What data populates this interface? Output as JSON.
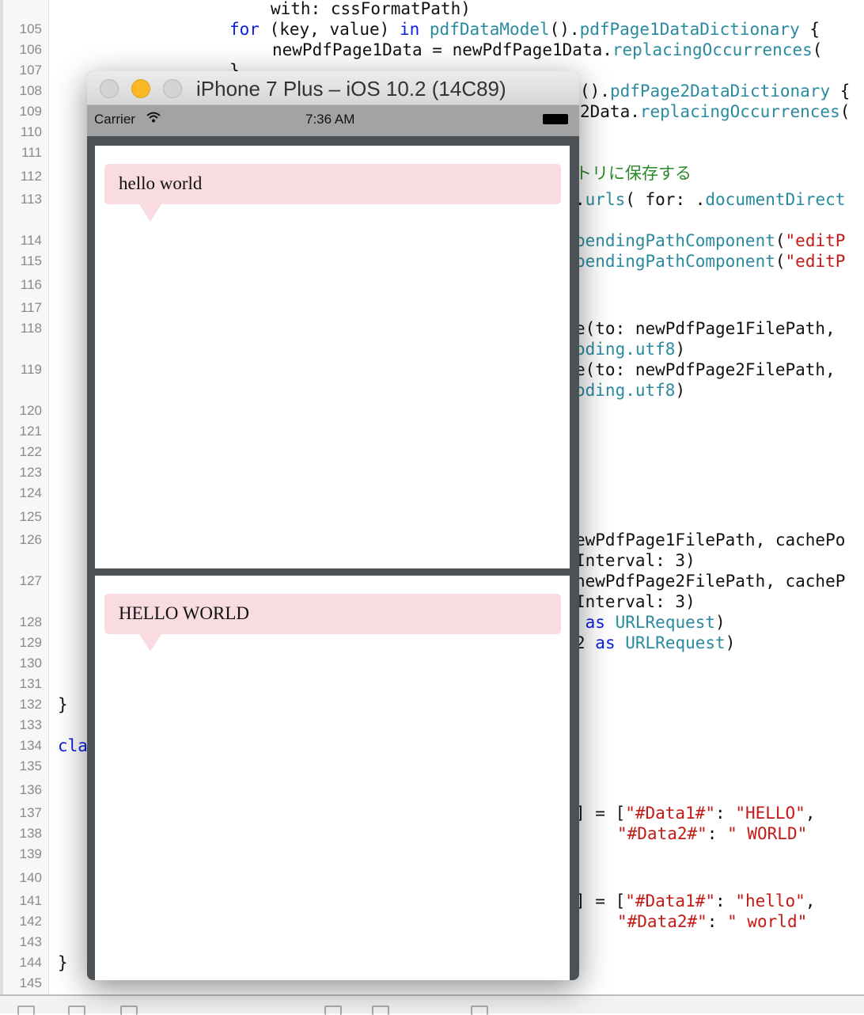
{
  "editor": {
    "line_numbers": [
      "105",
      "106",
      "107",
      "108",
      "109",
      "110",
      "111",
      "112",
      "113",
      "114",
      "115",
      "116",
      "117",
      "118",
      "119",
      "120",
      "121",
      "122",
      "123",
      "124",
      "125",
      "126",
      "127",
      "128",
      "129",
      "130",
      "131",
      "132",
      "133",
      "134",
      "135",
      "136",
      "137",
      "138",
      "139",
      "140",
      "141",
      "142",
      "143",
      "144",
      "145"
    ],
    "code": [
      [
        [
          "p",
          "with: cssFormatPath)"
        ]
      ],
      [
        [
          "k",
          "for"
        ],
        [
          "p",
          " (key, value) "
        ],
        [
          "k",
          "in"
        ],
        [
          "p",
          " "
        ],
        [
          "t",
          "pdfDataModel"
        ],
        [
          "p",
          "()."
        ],
        [
          "t",
          "pdfPage1DataDictionary"
        ],
        [
          "p",
          " {"
        ]
      ],
      [
        [
          "p",
          "newPdfPage1Data = newPdfPage1Data."
        ],
        [
          "t",
          "replacingOccurrences"
        ],
        [
          "p",
          "("
        ]
      ],
      [
        [
          "p",
          "}"
        ]
      ],
      [
        [
          "p",
          "()."
        ],
        [
          "t",
          "pdfPage2DataDictionary"
        ],
        [
          "p",
          " {"
        ]
      ],
      [
        [
          "p",
          "2Data."
        ],
        [
          "t",
          "replacingOccurrences"
        ],
        [
          "p",
          "("
        ]
      ],
      [
        [
          "c",
          "トリに保存する"
        ]
      ],
      [
        [
          "p",
          "."
        ],
        [
          "t",
          "urls"
        ],
        [
          "p",
          "( for: ."
        ],
        [
          "t",
          "documentDirect"
        ]
      ],
      [
        [
          "t",
          "pendingPathComponent"
        ],
        [
          "p",
          "("
        ],
        [
          "s",
          "\"editP"
        ]
      ],
      [
        [
          "t",
          "pendingPathComponent"
        ],
        [
          "p",
          "("
        ],
        [
          "s",
          "\"editP"
        ]
      ],
      [
        [
          "p",
          "e(to: newPdfPage1FilePath,"
        ]
      ],
      [
        [
          "t",
          "oding.utf8"
        ],
        [
          "p",
          ")"
        ]
      ],
      [
        [
          "p",
          "e(to: newPdfPage2FilePath,"
        ]
      ],
      [
        [
          "t",
          "oding.utf8"
        ],
        [
          "p",
          ")"
        ]
      ],
      [
        [
          "p",
          "ewPdfPage1FilePath, cachePo"
        ]
      ],
      [
        [
          "p",
          "Interval: 3)"
        ]
      ],
      [
        [
          "p",
          "newPdfPage2FilePath, cacheP"
        ]
      ],
      [
        [
          "p",
          "Interval: 3)"
        ]
      ],
      [
        [
          "p",
          " "
        ],
        [
          "k",
          "as"
        ],
        [
          "p",
          " "
        ],
        [
          "t",
          "URLRequest"
        ],
        [
          "p",
          ")"
        ]
      ],
      [
        [
          "p",
          "2 "
        ],
        [
          "k",
          "as"
        ],
        [
          "p",
          " "
        ],
        [
          "t",
          "URLRequest"
        ],
        [
          "p",
          ")"
        ]
      ],
      [
        [
          "p",
          "}"
        ]
      ],
      [
        [
          "k",
          "cla"
        ]
      ],
      [
        [
          "p",
          "] = ["
        ],
        [
          "s",
          "\"#Data1#\""
        ],
        [
          "p",
          ": "
        ],
        [
          "s",
          "\"HELLO\""
        ],
        [
          "p",
          ","
        ]
      ],
      [
        [
          "s",
          "\"#Data2#\""
        ],
        [
          "p",
          ": "
        ],
        [
          "s",
          "\" WORLD\""
        ]
      ],
      [
        [
          "p",
          "] = ["
        ],
        [
          "s",
          "\"#Data1#\""
        ],
        [
          "p",
          ": "
        ],
        [
          "s",
          "\"hello\""
        ],
        [
          "p",
          ","
        ]
      ],
      [
        [
          "s",
          "\"#Data2#\""
        ],
        [
          "p",
          ": "
        ],
        [
          "s",
          "\" world\""
        ]
      ],
      [
        [
          "p",
          "}"
        ]
      ]
    ]
  },
  "simulator": {
    "title": "iPhone 7 Plus – iOS 10.2 (14C89)",
    "status": {
      "carrier": "Carrier",
      "time": "7:36 AM",
      "wifi_icon": "wifi-icon",
      "battery_icon": "battery-icon"
    },
    "pages": [
      {
        "bubble_text": "hello world"
      },
      {
        "bubble_text": "HELLO WORLD"
      }
    ],
    "bubble_color": "#f8dce1"
  }
}
